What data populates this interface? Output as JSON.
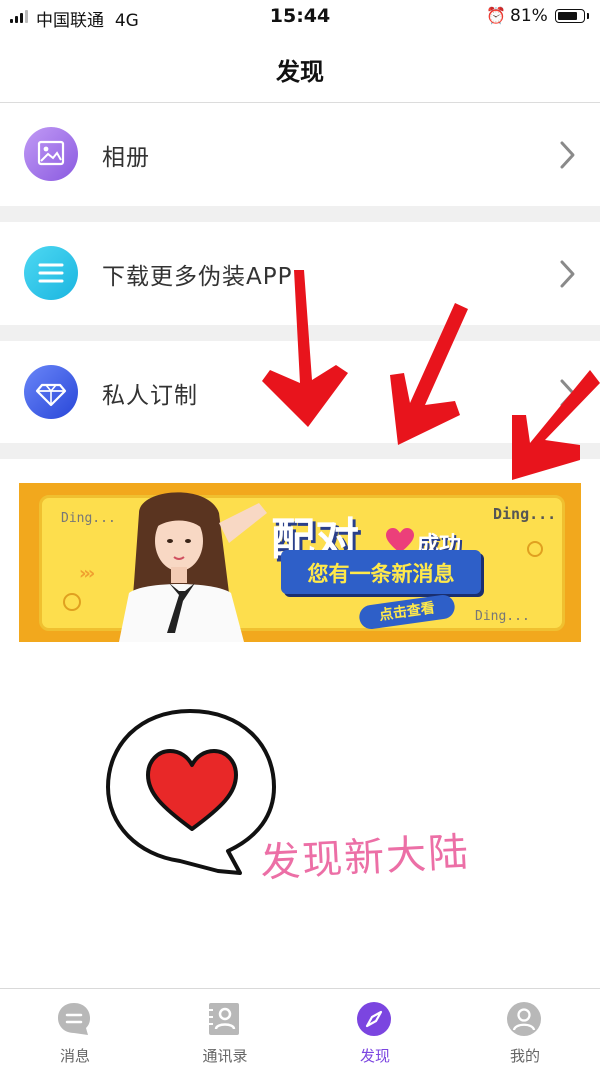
{
  "status_bar": {
    "carrier": "中国联通",
    "network": "4G",
    "time": "15:44",
    "battery_percent": "81%",
    "battery_level": 0.81,
    "alarm_icon": "alarm-clock-icon"
  },
  "nav": {
    "title": "发现"
  },
  "menu": {
    "items": [
      {
        "label": "相册",
        "icon": "album-icon",
        "icon_color": "#9d6fe8"
      },
      {
        "label": "下载更多伪装APP",
        "icon": "list-icon",
        "icon_color": "#2fc6ea"
      },
      {
        "label": "私人订制",
        "icon": "diamond-icon",
        "icon_color": "#3f5fe6"
      }
    ],
    "chevron_icon": "chevron-right-icon"
  },
  "banner": {
    "ding_texts": [
      "Ding...",
      "Ding...",
      "Ding..."
    ],
    "headline": "配对",
    "success": "成功",
    "message": "您有一条新消息",
    "cta": "点击查看"
  },
  "discover": {
    "text": "发现新大陆"
  },
  "tab_bar": {
    "tabs": [
      {
        "label": "消息",
        "icon": "chat-bubble-icon",
        "active": false
      },
      {
        "label": "通讯录",
        "icon": "contacts-icon",
        "active": false
      },
      {
        "label": "发现",
        "icon": "compass-icon",
        "active": true
      },
      {
        "label": "我的",
        "icon": "profile-icon",
        "active": false
      }
    ],
    "active_color": "#7b45e0"
  }
}
